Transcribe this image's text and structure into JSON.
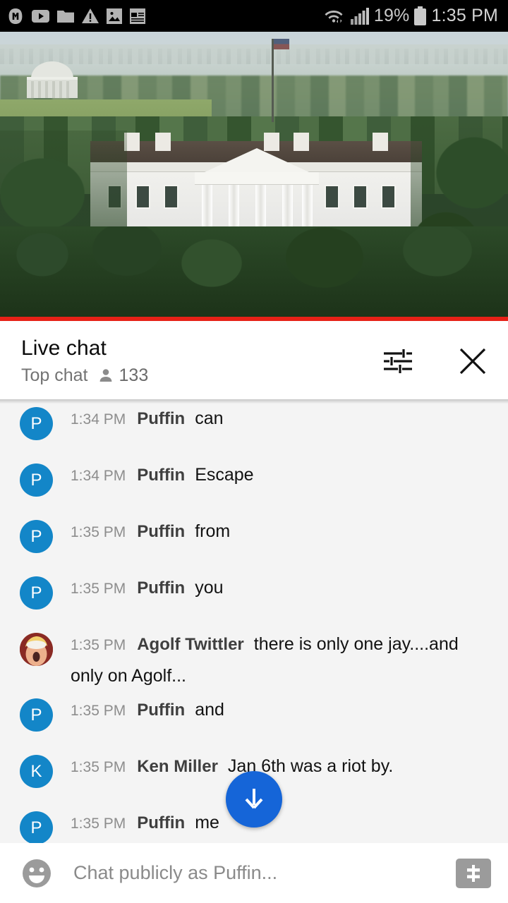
{
  "status_bar": {
    "icons": [
      "monogram-m-icon",
      "youtube-icon",
      "folder-icon",
      "warning-triangle-icon",
      "image-icon",
      "news-note-icon"
    ],
    "wifi_icon": "wifi-data-transfer-icon",
    "signal_icon": "cellular-signal-icon",
    "battery_percent": "19%",
    "battery_icon": "battery-icon",
    "time": "1:35 PM"
  },
  "video": {
    "description": "White House south lawn live stream",
    "progress_color": "#e62117",
    "is_live": true
  },
  "chat_header": {
    "title": "Live chat",
    "mode": "Top chat",
    "viewer_icon": "person-icon",
    "viewer_count": "133",
    "settings_icon": "tune-filter-icon",
    "close_icon": "close-x-icon"
  },
  "messages": [
    {
      "avatar_type": "initial",
      "initial": "P",
      "avatar_color": "#1386c8",
      "time": "1:34 PM",
      "author": "Puffin",
      "text": "can"
    },
    {
      "avatar_type": "initial",
      "initial": "P",
      "avatar_color": "#1386c8",
      "time": "1:34 PM",
      "author": "Puffin",
      "text": "Escape"
    },
    {
      "avatar_type": "initial",
      "initial": "P",
      "avatar_color": "#1386c8",
      "time": "1:35 PM",
      "author": "Puffin",
      "text": "from"
    },
    {
      "avatar_type": "initial",
      "initial": "P",
      "avatar_color": "#1386c8",
      "time": "1:35 PM",
      "author": "Puffin",
      "text": "you"
    },
    {
      "avatar_type": "photo",
      "initial": "",
      "avatar_color": "#8a2a24",
      "time": "1:35 PM",
      "author": "Agolf Twittler",
      "text": "there is only one jay....and only on Agolf..."
    },
    {
      "avatar_type": "initial",
      "initial": "P",
      "avatar_color": "#1386c8",
      "time": "1:35 PM",
      "author": "Puffin",
      "text": "and"
    },
    {
      "avatar_type": "initial",
      "initial": "K",
      "avatar_color": "#1386c8",
      "time": "1:35 PM",
      "author": "Ken Miller",
      "text": "Jan 6th was a riot by."
    },
    {
      "avatar_type": "initial",
      "initial": "P",
      "avatar_color": "#1386c8",
      "time": "1:35 PM",
      "author": "Puffin",
      "text": "me"
    }
  ],
  "scroll_button": {
    "icon": "arrow-down-icon",
    "color": "#1565d8"
  },
  "input_bar": {
    "emoji_icon": "emoji-smiley-icon",
    "placeholder": "Chat publicly as Puffin...",
    "value": "",
    "superchat_icon": "super-chat-dollar-icon"
  }
}
